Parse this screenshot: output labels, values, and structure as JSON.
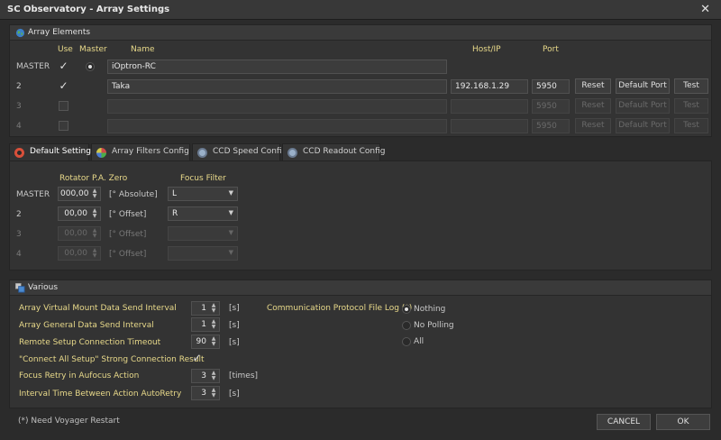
{
  "window": {
    "title": "SC Observatory - Array Settings",
    "close_glyph": "✕"
  },
  "array_elements": {
    "title": "Array Elements",
    "icon": "globe-icon",
    "headers": {
      "use": "Use",
      "master": "Master",
      "name": "Name",
      "host": "Host/IP",
      "port": "Port"
    },
    "rows": [
      {
        "label": "MASTER",
        "use": true,
        "master": true,
        "name": "iOptron-RC",
        "host": "",
        "port": "",
        "enabled": true,
        "has_buttons": false
      },
      {
        "label": "2",
        "use": true,
        "master": false,
        "name": "Taka",
        "host": "192.168.1.29",
        "port": "5950",
        "enabled": true,
        "has_buttons": true
      },
      {
        "label": "3",
        "use": false,
        "master": false,
        "name": "",
        "host": "",
        "port": "5950",
        "enabled": false,
        "has_buttons": true
      },
      {
        "label": "4",
        "use": false,
        "master": false,
        "name": "",
        "host": "",
        "port": "5950",
        "enabled": false,
        "has_buttons": true
      }
    ],
    "buttons": {
      "reset": "Reset",
      "default_port": "Default Port",
      "test": "Test"
    }
  },
  "tabs": [
    {
      "label": "Default Setting",
      "active": true,
      "icon": "target-icon",
      "color": "#d9503a"
    },
    {
      "label": "Array Filters Config",
      "active": false,
      "icon": "filter-wheel-icon",
      "color": "#9a6fd0"
    },
    {
      "label": "CCD Speed Config",
      "active": false,
      "icon": "ccd-speed-icon",
      "color": "#9ab0c8"
    },
    {
      "label": "CCD Readout Config",
      "active": false,
      "icon": "ccd-readout-icon",
      "color": "#9ab0c8"
    }
  ],
  "default_setting": {
    "headers": {
      "rotator": "Rotator P.A. Zero",
      "focus_filter": "Focus Filter"
    },
    "rows": [
      {
        "label": "MASTER",
        "value": "000,00",
        "unit": "[° Absolute]",
        "filter": "L",
        "enabled": true
      },
      {
        "label": "2",
        "value": "00,00",
        "unit": "[° Offset]",
        "filter": "R",
        "enabled": true
      },
      {
        "label": "3",
        "value": "00,00",
        "unit": "[° Offset]",
        "filter": "",
        "enabled": false
      },
      {
        "label": "4",
        "value": "00,00",
        "unit": "[° Offset]",
        "filter": "",
        "enabled": false
      }
    ]
  },
  "various": {
    "title": "Various",
    "icon": "various-icon",
    "settings": [
      {
        "label": "Array Virtual Mount Data Send Interval",
        "value": "1",
        "unit": "[s]",
        "type": "spin"
      },
      {
        "label": "Array General Data Send Interval",
        "value": "1",
        "unit": "[s]",
        "type": "spin"
      },
      {
        "label": "Remote Setup Connection Timeout",
        "value": "90",
        "unit": "[s]",
        "type": "spin"
      },
      {
        "label": "\"Connect All Setup\" Strong Connection Result",
        "value": true,
        "unit": "",
        "type": "check"
      },
      {
        "label": "Focus Retry in Aufocus Action",
        "value": "3",
        "unit": "[times]",
        "type": "spin"
      },
      {
        "label": "Interval Time Between Action AutoRetry",
        "value": "3",
        "unit": "[s]",
        "type": "spin"
      }
    ],
    "comm_log": {
      "label": "Communication Protocol File Log (*)",
      "options": [
        "Nothing",
        "No Polling",
        "All"
      ],
      "selected": "Nothing"
    }
  },
  "footer": {
    "note": "(*) Need Voyager Restart",
    "cancel": "CANCEL",
    "ok": "OK"
  }
}
